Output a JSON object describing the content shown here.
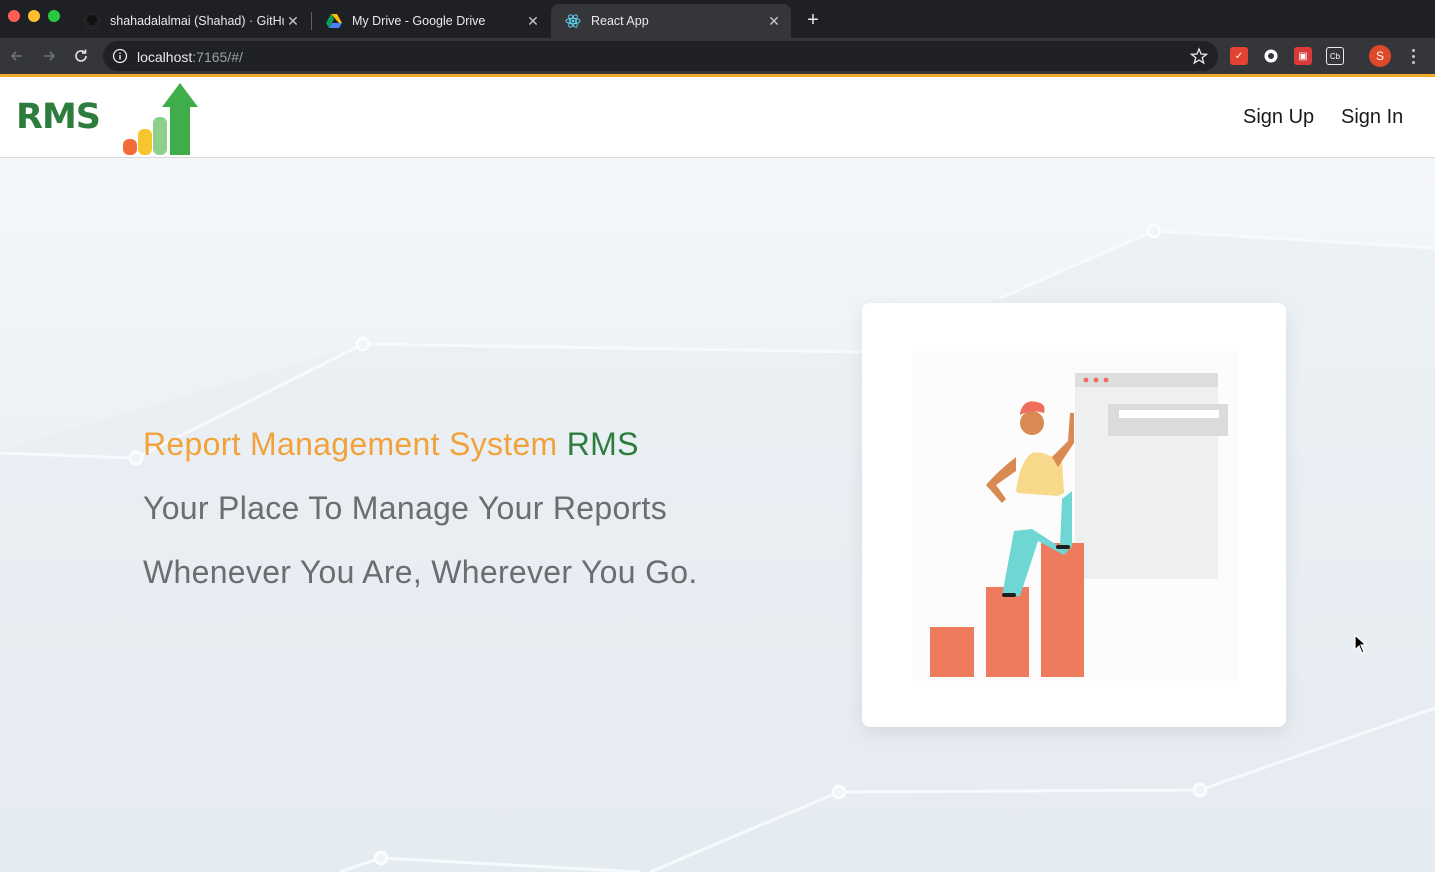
{
  "browser": {
    "tabs": [
      {
        "title": "shahadalalmai (Shahad) · GitHub",
        "icon": "github-icon",
        "active": false
      },
      {
        "title": "My Drive - Google Drive",
        "icon": "google-drive-icon",
        "active": false
      },
      {
        "title": "React App",
        "icon": "react-icon",
        "active": true
      }
    ],
    "url_host": "localhost",
    "url_path": ":7165/#/",
    "profile_initial": "S",
    "extensions": [
      "todoist-icon",
      "extension-circle-icon",
      "extension-gift-icon",
      "extension-cb-icon"
    ],
    "accent_color": "#f4a92c"
  },
  "header": {
    "brand": "RMS",
    "nav": {
      "sign_up": "Sign Up",
      "sign_in": "Sign In"
    }
  },
  "hero": {
    "headline_part1": "Report Management System",
    "headline_part2": "RMS",
    "line1": "Your Place To Manage Your Reports",
    "line2": "Whenever You Are, Wherever You Go.",
    "colors": {
      "orange": "#f2a23c",
      "green": "#2f7d3e",
      "gray": "#6b6e70"
    }
  }
}
